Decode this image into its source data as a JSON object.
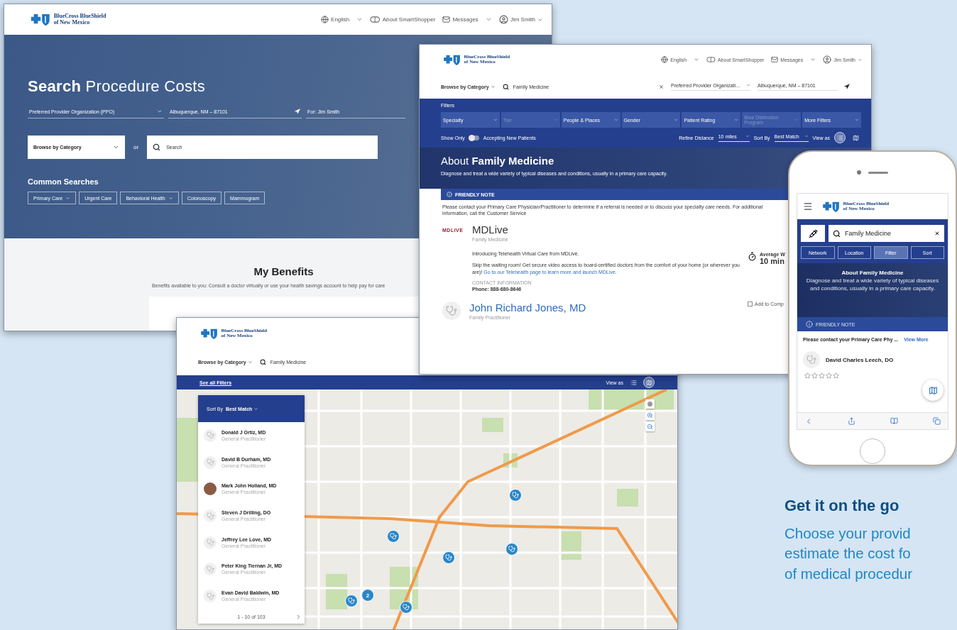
{
  "home_page": {
    "logo": {
      "line1": "BlueCross BlueShield",
      "line2": "of New Mexico"
    },
    "nav": {
      "language": "English",
      "about": "About SmartShopper",
      "messages": "Messages",
      "user": "Jim Smith"
    },
    "title": "**Search** Procedure Costs",
    "plan": "Preferred Provider Organization (PPO)",
    "location": "Albuquerque, NM – 87101",
    "for_label": "For: Jim Smith",
    "browse": "Browse by Category",
    "or": "or",
    "search": {
      "placeholder": "Search"
    },
    "common_title": "Common Searches",
    "chips": [
      {
        "label": "Primary Care",
        "dropdown": true
      },
      {
        "label": "Urgent Care",
        "dropdown": false
      },
      {
        "label": "Behavioral Health",
        "dropdown": true
      },
      {
        "label": "Colonoscopy",
        "dropdown": false
      },
      {
        "label": "Mammogram",
        "dropdown": false
      }
    ],
    "benefits_title": "My Benefits",
    "benefits_text": "Benefits available to you: Consult a doctor virtually or use your health savings account to help pay for care"
  },
  "results_page": {
    "logo": {
      "line1": "BlueCross BlueShield",
      "line2": "of New Mexico"
    },
    "nav": {
      "language": "English",
      "about": "About SmartShopper",
      "messages": "Messages",
      "user": "Jim Smith"
    },
    "browse": "Browse by Category",
    "search_value": "Family Medicine",
    "plan": "Preferred Provider Organizati…",
    "location": "Albuquerque, NM – 87101",
    "filters_label": "Filters",
    "filters": [
      {
        "label": "Specialty",
        "disabled": false
      },
      {
        "label": "Tier",
        "disabled": true
      },
      {
        "label": "People & Places",
        "disabled": false
      },
      {
        "label": "Gender",
        "disabled": false
      },
      {
        "label": "Patient Rating",
        "disabled": false
      },
      {
        "label": "Blue Distinction Program",
        "disabled": true
      },
      {
        "label": "More Filters",
        "disabled": false
      }
    ],
    "show_only": "Show Only",
    "accepting": {
      "label": "Accepting New Patients",
      "on": false
    },
    "distance_label": "Refine Distance",
    "distance": "10 miles",
    "sort_label": "Sort By",
    "sort": "Best Match",
    "view_label": "View as",
    "views": [
      {
        "kind": "list",
        "selected": true
      },
      {
        "kind": "map",
        "selected": false
      }
    ],
    "about_title": "About **Family Medicine**",
    "about_text": "Diagnose and treat a wide variety of typical diseases and conditions, usually in a primary care capacity.",
    "note_title": "FRIENDLY NOTE",
    "note_text": "Please contact your Primary Care Physician/Practitioner to determine if a referral is needed or to discuss your specialty care needs. For additional information, call the Customer Service",
    "mdlive": {
      "logo": "MDLIVE",
      "name": "MDLive",
      "specialty": "Family Medicine",
      "intro": "Introducing Telehealth Virtual Care from MDLive.",
      "body": "Skip the waiting room! Get secure video access to board-certified doctors from the comfort of your home (or wherever you are)!",
      "link": "Go to our Telehealth page to learn more and launch MDLive.",
      "contact_label": "CONTACT INFORMATION",
      "phone": "Phone: 888-680-8646",
      "wait_label": "Average W",
      "wait": "10 min"
    },
    "provider": {
      "name": "John Richard Jones, MD",
      "specialty": "Family Practitioner",
      "compare": {
        "label": "Add to Comp",
        "checked": false
      }
    }
  },
  "map_page": {
    "logo": {
      "line1": "BlueCross BlueShield",
      "line2": "of New Mexico"
    },
    "browse": "Browse by Category",
    "search_value": "Family Medicine",
    "see_filters": "See all Filters",
    "view_label": "View as",
    "views": [
      {
        "kind": "list",
        "selected": false
      },
      {
        "kind": "map",
        "selected": true
      }
    ],
    "sort_label": "Sort By",
    "sort": "Best Match",
    "providers": [
      {
        "name": "Donald J Ortiz, MD",
        "specialty": "General Practitioner",
        "photo": false
      },
      {
        "name": "David B Durham, MD",
        "specialty": "General Practitioner",
        "photo": false
      },
      {
        "name": "Mark John Holland, MD",
        "specialty": "General Practitioner",
        "photo": true
      },
      {
        "name": "Steven J Drilling, DO",
        "specialty": "General Practitioner",
        "photo": false
      },
      {
        "name": "Jeffrey Lee Love, MD",
        "specialty": "General Practitioner",
        "photo": false
      },
      {
        "name": "Peter King Tiernan Jr, MD",
        "specialty": "General Practitioner",
        "photo": false
      },
      {
        "name": "Evan David Baldwin, MD",
        "specialty": "General Practitioner",
        "photo": false
      }
    ],
    "pager": "1 - 10 of 103",
    "markers": [
      {
        "kind": "pin"
      },
      {
        "kind": "pin"
      },
      {
        "kind": "pin"
      },
      {
        "kind": "pin"
      },
      {
        "kind": "cluster",
        "count": "2"
      },
      {
        "kind": "pin"
      },
      {
        "kind": "pin"
      }
    ]
  },
  "phone": {
    "logo": {
      "line1": "BlueCross BlueShield",
      "line2": "of New Mexico"
    },
    "search_value": "Family Medicine",
    "buttons": [
      {
        "label": "Network",
        "selected": false
      },
      {
        "label": "Location",
        "selected": false
      },
      {
        "label": "Filter",
        "selected": true
      },
      {
        "label": "Sort",
        "selected": false
      }
    ],
    "about_title": "About Family Medicine",
    "about_text": "Diagnose and treat a wide variety of typical diseases and conditions, usually in a primary care capacity.",
    "note_title": "FRIENDLY NOTE",
    "note_text": "Please contact your Primary Care Phy ...",
    "view_more": "View More",
    "provider": {
      "name": "David Charles Leech, DO",
      "stars": 0
    }
  },
  "promo": {
    "title": "Get it on the go",
    "lines": [
      "Choose your provid",
      "estimate the cost fo",
      "of medical procedur"
    ]
  }
}
